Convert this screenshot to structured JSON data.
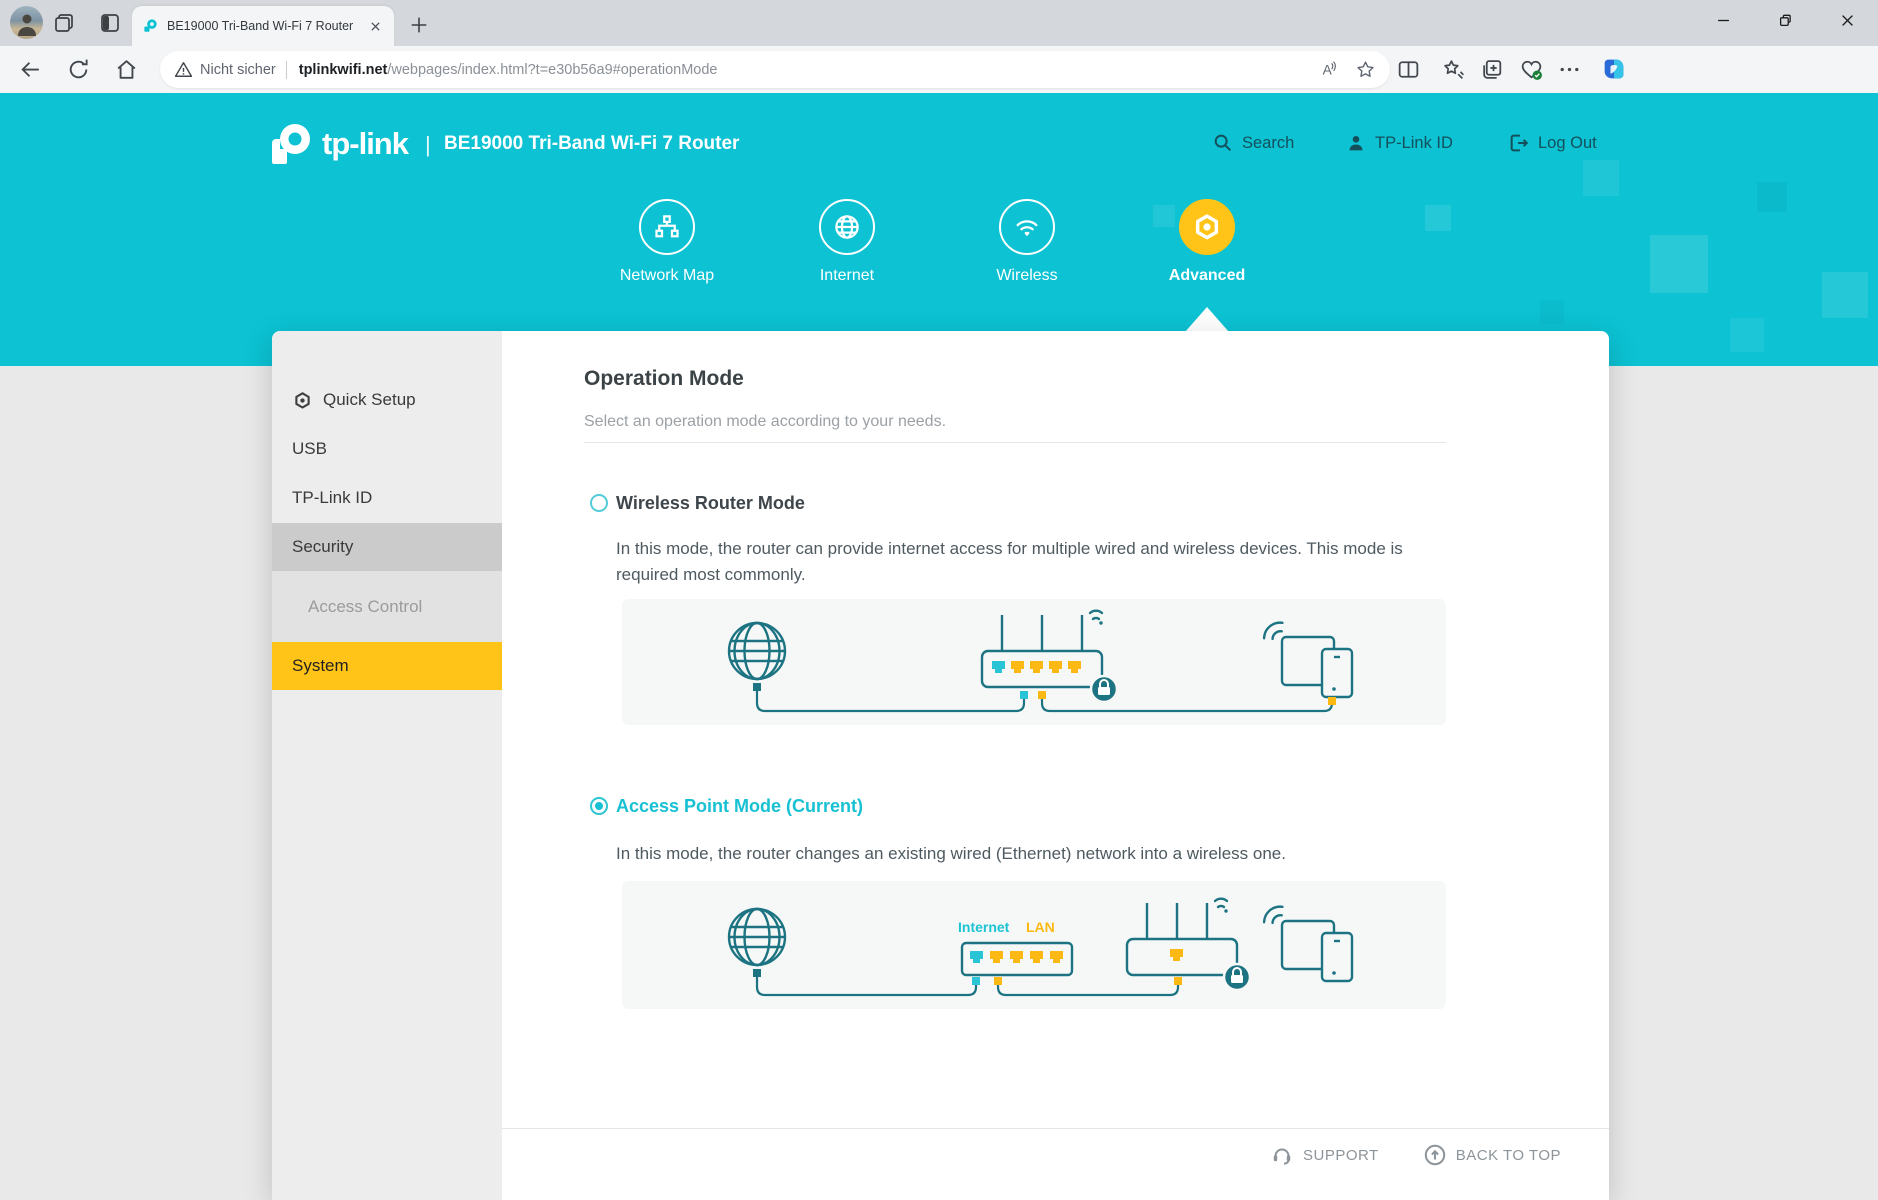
{
  "browser": {
    "tab_title": "BE19000 Tri-Band Wi-Fi 7 Router",
    "security_label": "Nicht sicher",
    "url_host": "tplinkwifi.net",
    "url_path": "/webpages/index.html?t=e30b56a9#operationMode"
  },
  "header": {
    "brand": "tp-link",
    "separator": "|",
    "device_title": "BE19000 Tri-Band Wi-Fi 7 Router",
    "search_label": "Search",
    "tplink_id_label": "TP-Link ID",
    "logout_label": "Log Out"
  },
  "nav": {
    "items": [
      {
        "label": "Network Map"
      },
      {
        "label": "Internet"
      },
      {
        "label": "Wireless"
      },
      {
        "label": "Advanced",
        "active": true
      }
    ]
  },
  "sidebar": {
    "items": [
      {
        "label": "Quick Setup",
        "state": "normal"
      },
      {
        "label": "USB",
        "state": "normal"
      },
      {
        "label": "TP-Link ID",
        "state": "normal"
      },
      {
        "label": "Security",
        "state": "hover"
      },
      {
        "label": "Access Control",
        "state": "submenu"
      },
      {
        "label": "System",
        "state": "selected"
      }
    ]
  },
  "content": {
    "title": "Operation Mode",
    "subtitle": "Select an operation mode according to your needs.",
    "modes": [
      {
        "label": "Wireless Router Mode",
        "selected": false,
        "description": "In this mode, the router can provide internet access for multiple wired and wireless devices. This mode is required most commonly."
      },
      {
        "label": "Access Point Mode (Current)",
        "selected": true,
        "description": "In this mode, the router changes an existing wired (Ethernet) network into a wireless one."
      }
    ],
    "diagram_labels": {
      "internet": "Internet",
      "lan": "LAN"
    }
  },
  "footer": {
    "support": "SUPPORT",
    "back_to_top": "BACK TO TOP"
  },
  "colors": {
    "teal": "#0CC2D3",
    "yellow": "#FFC417",
    "accent": "#17C1D3",
    "line_art": "#1C7381",
    "port_cyan": "#29C5D6",
    "port_yellow": "#FDB913",
    "sidebar_hover": "#CBCBCB"
  }
}
